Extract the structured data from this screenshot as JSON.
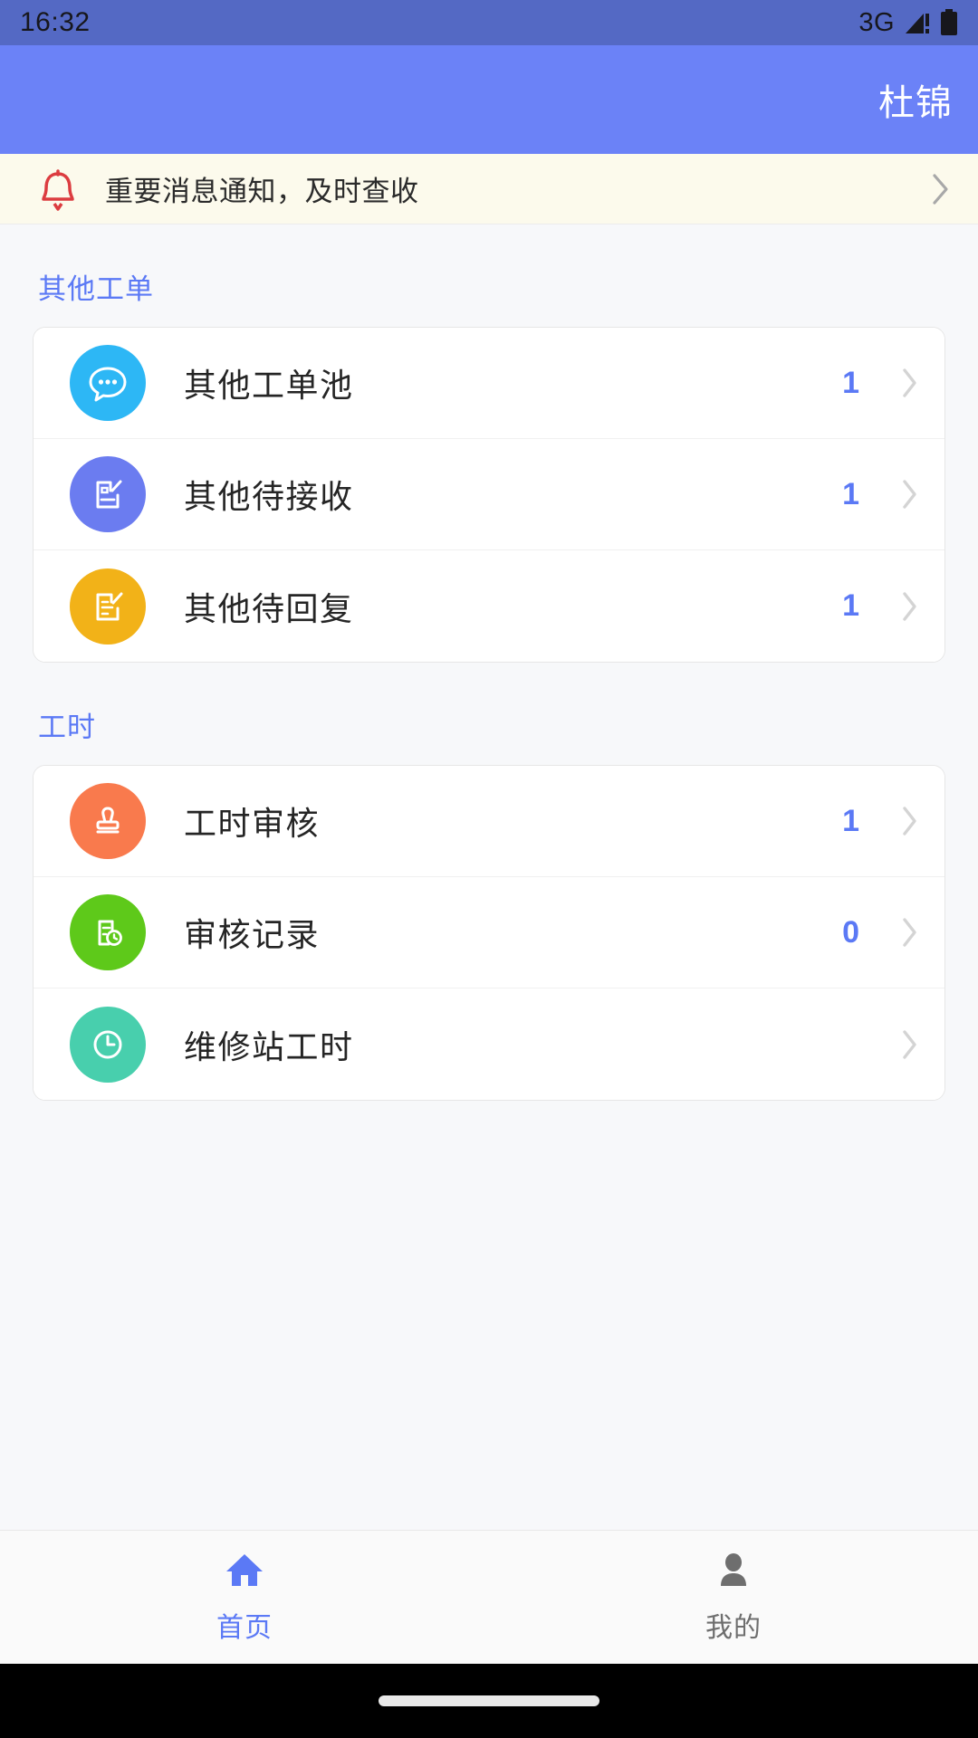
{
  "status_bar": {
    "time": "16:32",
    "network": "3G",
    "signal_icon": "signal-bars-warning-icon",
    "battery_icon": "battery-full-icon"
  },
  "app_bar": {
    "user_name": "杜锦"
  },
  "notice": {
    "icon": "bell-icon",
    "text": "重要消息通知，及时查收",
    "chevron_icon": "chevron-right-icon"
  },
  "sections": [
    {
      "title": "其他工单",
      "items": [
        {
          "label": "其他工单池",
          "count": "1",
          "icon": "chat-bubble-dots-icon",
          "icon_color": "#2db7f5"
        },
        {
          "label": "其他待接收",
          "count": "1",
          "icon": "document-edit-icon",
          "icon_color": "#6b7cf0"
        },
        {
          "label": "其他待回复",
          "count": "1",
          "icon": "document-pen-icon",
          "icon_color": "#f2b218"
        }
      ]
    },
    {
      "title": "工时",
      "items": [
        {
          "label": "工时审核",
          "count": "1",
          "icon": "stamp-icon",
          "icon_color": "#f97a4d"
        },
        {
          "label": "审核记录",
          "count": "0",
          "icon": "document-clock-icon",
          "icon_color": "#5ec91a"
        },
        {
          "label": "维修站工时",
          "count": "",
          "icon": "clock-icon",
          "icon_color": "#48cfad"
        }
      ]
    }
  ],
  "tab_bar": {
    "tabs": [
      {
        "label": "首页",
        "icon": "home-icon",
        "active": true
      },
      {
        "label": "我的",
        "icon": "person-icon",
        "active": false
      }
    ]
  },
  "colors": {
    "status_bar_bg": "#5469c4",
    "app_bar_bg": "#6b82f7",
    "accent": "#5b79f5",
    "notice_bg": "#fcfaec",
    "bell": "#dc3c40",
    "page_bg": "#f7f8fa"
  }
}
